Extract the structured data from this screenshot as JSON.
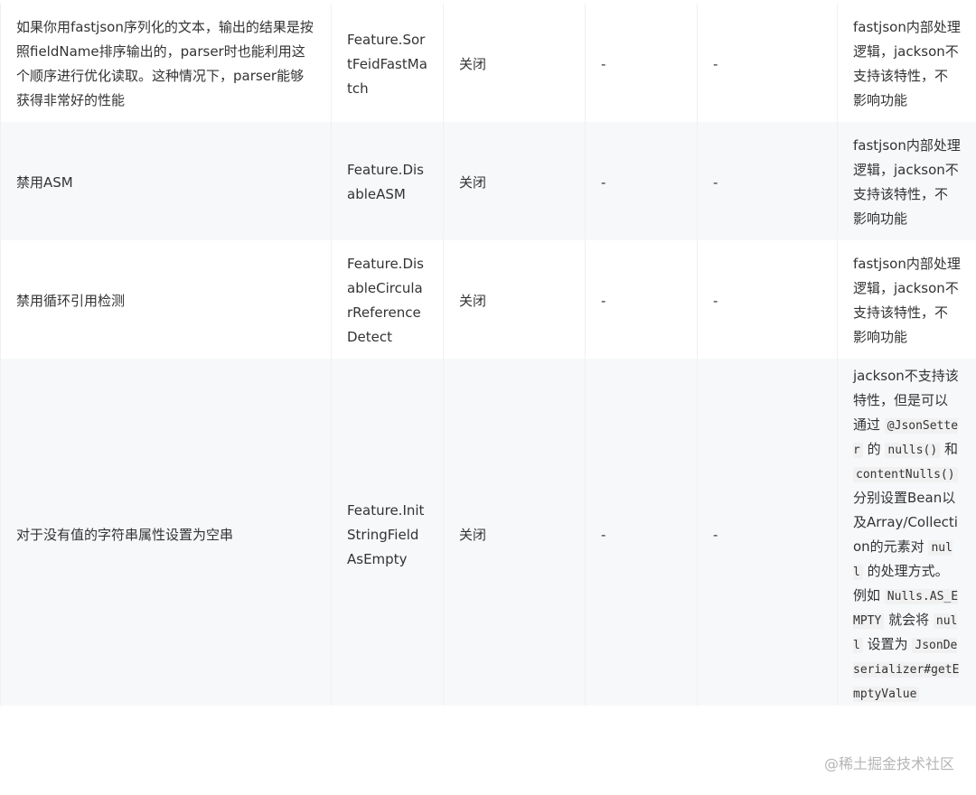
{
  "rows": [
    {
      "description": "如果你用fastjson序列化的文本，输出的结果是按照fieldName排序输出的，parser时也能利用这个顺序进行优化读取。这种情况下，parser能够获得非常好的性能",
      "feature": "Feature.SortFeidFastMatch",
      "default": "关闭",
      "jackson_feature": "-",
      "jackson_default": "-",
      "notes": "fastjson内部处理逻辑，jackson不支持该特性，不影响功能"
    },
    {
      "description": "禁用ASM",
      "feature": "Feature.DisableASM",
      "default": "关闭",
      "jackson_feature": "-",
      "jackson_default": "-",
      "notes": "fastjson内部处理逻辑，jackson不支持该特性，不影响功能"
    },
    {
      "description": "禁用循环引用检测",
      "feature": "Feature.DisableCircularReferenceDetect",
      "default": "关闭",
      "jackson_feature": "-",
      "jackson_default": "-",
      "notes": "fastjson内部处理逻辑，jackson不支持该特性，不影响功能"
    },
    {
      "description": "对于没有值的字符串属性设置为空串",
      "feature": "Feature.InitStringFieldAsEmpty",
      "default": "关闭",
      "jackson_feature": "-",
      "jackson_default": "-",
      "notes_parts": {
        "t1": "jackson不支持该特性，但是可以通过",
        "c1": "@JsonSetter",
        "t2": "的",
        "c2": "nulls()",
        "t3": "和",
        "c3": "contentNulls()",
        "t4": "分别设置Bean以及Array/Collection的元素对",
        "c4": "null",
        "t5": "的处理方式。例如",
        "c5": "Nulls.AS_EMPTY",
        "t6": "就会将",
        "c6": "null",
        "t7": "设置为",
        "c7": "JsonDeserializer#getEmptyValue"
      }
    }
  ],
  "watermark": "@稀土掘金技术社区"
}
